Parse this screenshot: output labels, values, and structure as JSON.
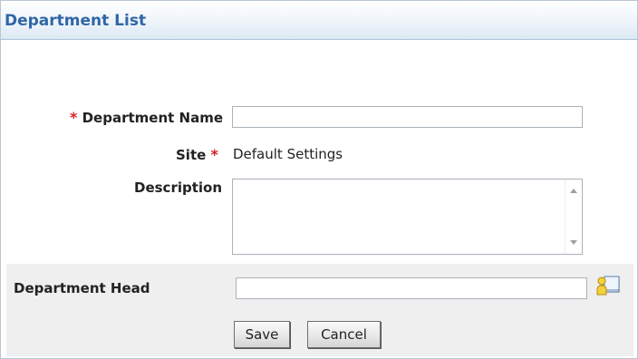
{
  "header": {
    "title": "Department List"
  },
  "form": {
    "department_name": {
      "required_mark": "*",
      "label": "Department Name",
      "value": ""
    },
    "site": {
      "label": "Site",
      "required_mark": "*",
      "value": "Default Settings"
    },
    "description": {
      "label": "Description",
      "value": ""
    },
    "department_head": {
      "label": "Department Head",
      "value": ""
    }
  },
  "buttons": {
    "save": "Save",
    "cancel": "Cancel"
  },
  "icons": {
    "user_lookup": "user-lookup-icon"
  },
  "colors": {
    "title": "#2f66a6",
    "required": "#d62121",
    "band": "#efefef"
  }
}
